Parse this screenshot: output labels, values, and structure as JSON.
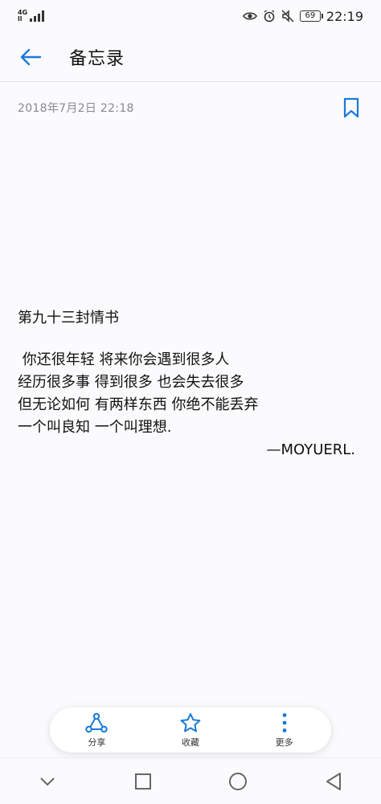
{
  "status_bar": {
    "network": "4G",
    "network_sub": "ll",
    "battery": "69",
    "time": "22:19"
  },
  "header": {
    "title": "备忘录"
  },
  "note": {
    "date": "2018年7月2日 22:18",
    "title": "第九十三封情书",
    "lines": [
      " 你还很年轻 将来你会遇到很多人",
      "经历很多事 得到很多 也会失去很多",
      "但无论如何 有两样东西 你绝不能丢弃",
      "一个叫良知 一个叫理想."
    ],
    "signature": "—MOYUERL."
  },
  "actions": {
    "share": "分享",
    "favorite": "收藏",
    "more": "更多"
  },
  "colors": {
    "accent": "#1a7ad9",
    "text": "#111111",
    "muted": "#8a8a8f"
  }
}
